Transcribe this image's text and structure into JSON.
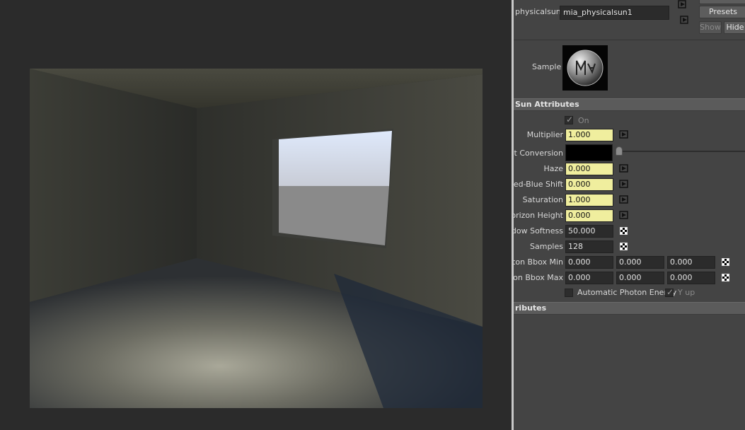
{
  "node": {
    "label": "physicalsun:",
    "name": "mia_physicalsun1"
  },
  "buttons": {
    "presets": "Presets",
    "show": "Show",
    "hide": "Hide"
  },
  "sample": {
    "label": "Sample"
  },
  "sun_attributes": {
    "header": "Sun Attributes",
    "on_label": "On",
    "multiplier": {
      "label": "Multiplier",
      "value": "1.000"
    },
    "unit_conversion": {
      "label": "nit Conversion"
    },
    "haze": {
      "label": "Haze",
      "value": "0.000"
    },
    "red_blue_shift": {
      "label": "Red-Blue Shift",
      "value": "0.000"
    },
    "saturation": {
      "label": "Saturation",
      "value": "1.000"
    },
    "horizon_height": {
      "label": "Horizon Height",
      "value": "0.000"
    },
    "shadow_softness": {
      "label": "adow Softness",
      "value": "50.000"
    },
    "samples": {
      "label": "Samples",
      "value": "128"
    },
    "photon_bbox_min": {
      "label": "oton Bbox Min",
      "values": [
        "0.000",
        "0.000",
        "0.000"
      ]
    },
    "photon_bbox_max": {
      "label": "oton Bbox Max",
      "values": [
        "0.000",
        "0.000",
        "0.000"
      ]
    },
    "automatic_photon_energy": "Automatic Photon Energy",
    "y_up": "Y up"
  },
  "extra_attributes": {
    "header": "ributes"
  },
  "colors": {
    "panel_bg": "#444444",
    "field_highlight": "#f0ee9e",
    "field_dark": "#2b2b2b"
  }
}
